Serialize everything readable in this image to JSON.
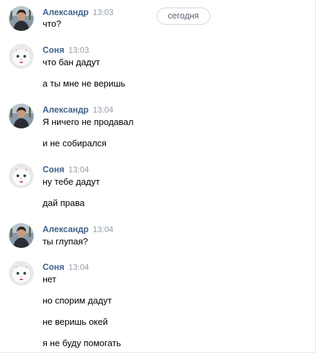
{
  "chat": {
    "date_separator": "сегодня",
    "messages": [
      {
        "author": "Александр",
        "time": "13:03",
        "avatar": "man-photo-avatar",
        "lines": [
          "что?"
        ]
      },
      {
        "author": "Соня",
        "time": "13:03",
        "avatar": "white-cat-avatar",
        "lines": [
          "что бан дадут",
          "а ты мне не веришь"
        ]
      },
      {
        "author": "Александр",
        "time": "13:04",
        "avatar": "man-photo-avatar",
        "lines": [
          "Я ничего не продавал",
          "и не собирался"
        ]
      },
      {
        "author": "Соня",
        "time": "13:04",
        "avatar": "white-cat-avatar",
        "lines": [
          "ну тебе дадут",
          "дай права"
        ]
      },
      {
        "author": "Александр",
        "time": "13:04",
        "avatar": "man-photo-avatar",
        "lines": [
          "ты глупая?"
        ]
      },
      {
        "author": "Соня",
        "time": "13:04",
        "avatar": "white-cat-avatar",
        "lines": [
          "нет",
          "но спорим дадут",
          "не веришь окей",
          "я не буду помогать"
        ]
      }
    ]
  },
  "colors": {
    "author_name": "#42648b",
    "timestamp": "#939ea9",
    "message_text": "#000000",
    "pill_border": "#cfd6de"
  }
}
